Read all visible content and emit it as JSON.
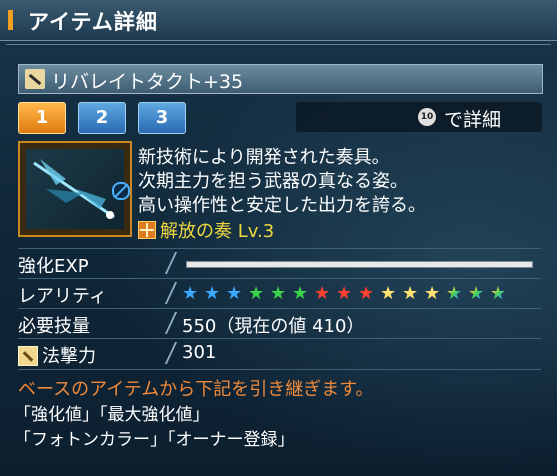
{
  "window": {
    "title": "アイテム詳細"
  },
  "item": {
    "name": "リバレイトタクト+35"
  },
  "tabs": [
    {
      "label": "1",
      "active": true
    },
    {
      "label": "2",
      "active": false
    },
    {
      "label": "3",
      "active": false
    }
  ],
  "detail_hint": {
    "key": "10",
    "label": "で詳細"
  },
  "description": [
    "新技術により開発された奏具。",
    "次期主力を担う武器の真なる姿。",
    "高い操作性と安定した出力を誇る。"
  ],
  "skill": {
    "name": "解放の奏 Lv.3"
  },
  "stats": {
    "exp_label": "強化EXP",
    "exp_progress": 0,
    "rarity_label": "レアリティ",
    "rarity_stars": 15,
    "rarity_colors": [
      "#3aa8ff",
      "#3aa8ff",
      "#3aa8ff",
      "#3ad24a",
      "#3ad24a",
      "#3ad24a",
      "#ff4030",
      "#ff4030",
      "#ff4030",
      "#ffe070",
      "#ffe070",
      "#ffe070",
      "rainbow",
      "rainbow",
      "rainbow"
    ],
    "required_label": "必要技量",
    "required_value": "550（現在の値 410）",
    "attack_label": "法撃力",
    "attack_value": "301"
  },
  "inherit": {
    "title": "ベースのアイテムから下記を引き継ぎます。",
    "line1": "「強化値」「最大強化値」",
    "line2": "「フォトンカラー」「オーナー登録」"
  },
  "icons": {
    "weapon": "rod-weapon-icon",
    "key": "key-10-icon",
    "restriction": "no-entry-icon",
    "skill": "cross-burst-icon",
    "attack": "rod-attack-icon"
  }
}
